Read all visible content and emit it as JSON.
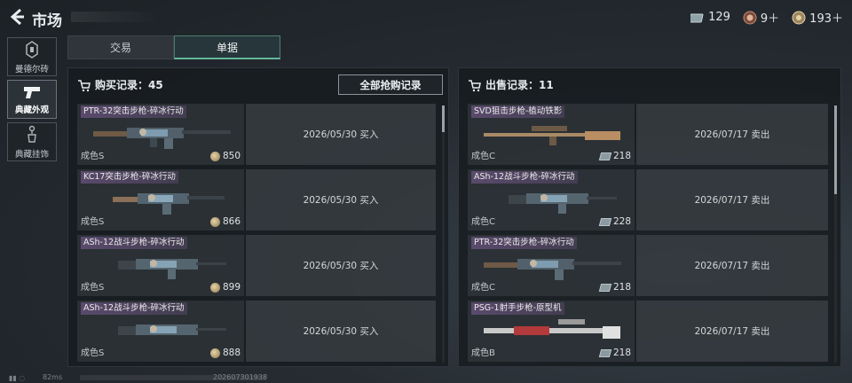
{
  "header": {
    "title": "市场",
    "currencies": [
      {
        "icon": "ticket-icon",
        "value": "129"
      },
      {
        "icon": "medal-icon",
        "value": "9＋"
      },
      {
        "icon": "coin-icon",
        "value": "193＋"
      }
    ]
  },
  "sidebar": {
    "items": [
      {
        "label": "曼德尔砖",
        "icon": "brick-icon"
      },
      {
        "label": "典藏外观",
        "icon": "pistol-icon"
      },
      {
        "label": "典藏挂饰",
        "icon": "charm-icon"
      }
    ]
  },
  "tabs": [
    {
      "label": "交易"
    },
    {
      "label": "单据"
    }
  ],
  "purchase": {
    "title": "购买记录：45",
    "all_button": "全部抢购记录",
    "rows": [
      {
        "name": "PTR-32突击步枪-碎冰行动",
        "grade": "成色S",
        "price": "850",
        "info": "2026/05/30 买入"
      },
      {
        "name": "KC17突击步枪-碎冰行动",
        "grade": "成色S",
        "price": "866",
        "info": "2026/05/30 买入"
      },
      {
        "name": "ASh-12战斗步枪-碎冰行动",
        "grade": "成色S",
        "price": "899",
        "info": "2026/05/30 买入"
      },
      {
        "name": "ASh-12战斗步枪-碎冰行动",
        "grade": "成色S",
        "price": "888",
        "info": "2026/05/30 买入"
      }
    ]
  },
  "sales": {
    "title": "出售记录：11",
    "rows": [
      {
        "name": "SVD狙击步枪-植动铁影",
        "grade": "成色C",
        "price": "218",
        "info": "2026/07/17 卖出"
      },
      {
        "name": "ASh-12战斗步枪-碎冰行动",
        "grade": "成色C",
        "price": "228",
        "info": "2026/07/17 卖出"
      },
      {
        "name": "PTR-32突击步枪-碎冰行动",
        "grade": "成色C",
        "price": "218",
        "info": "2026/07/17 卖出"
      },
      {
        "name": "PSG-1射手步枪-原型机",
        "grade": "成色B",
        "price": "218",
        "info": "2026/07/17 卖出"
      }
    ]
  },
  "status": {
    "ping": "82ms",
    "uid": "202607301938"
  },
  "colors": {
    "accent": "#63b99a",
    "name_tag": "#5a4a6c",
    "panel_bg": "#161b1f"
  }
}
